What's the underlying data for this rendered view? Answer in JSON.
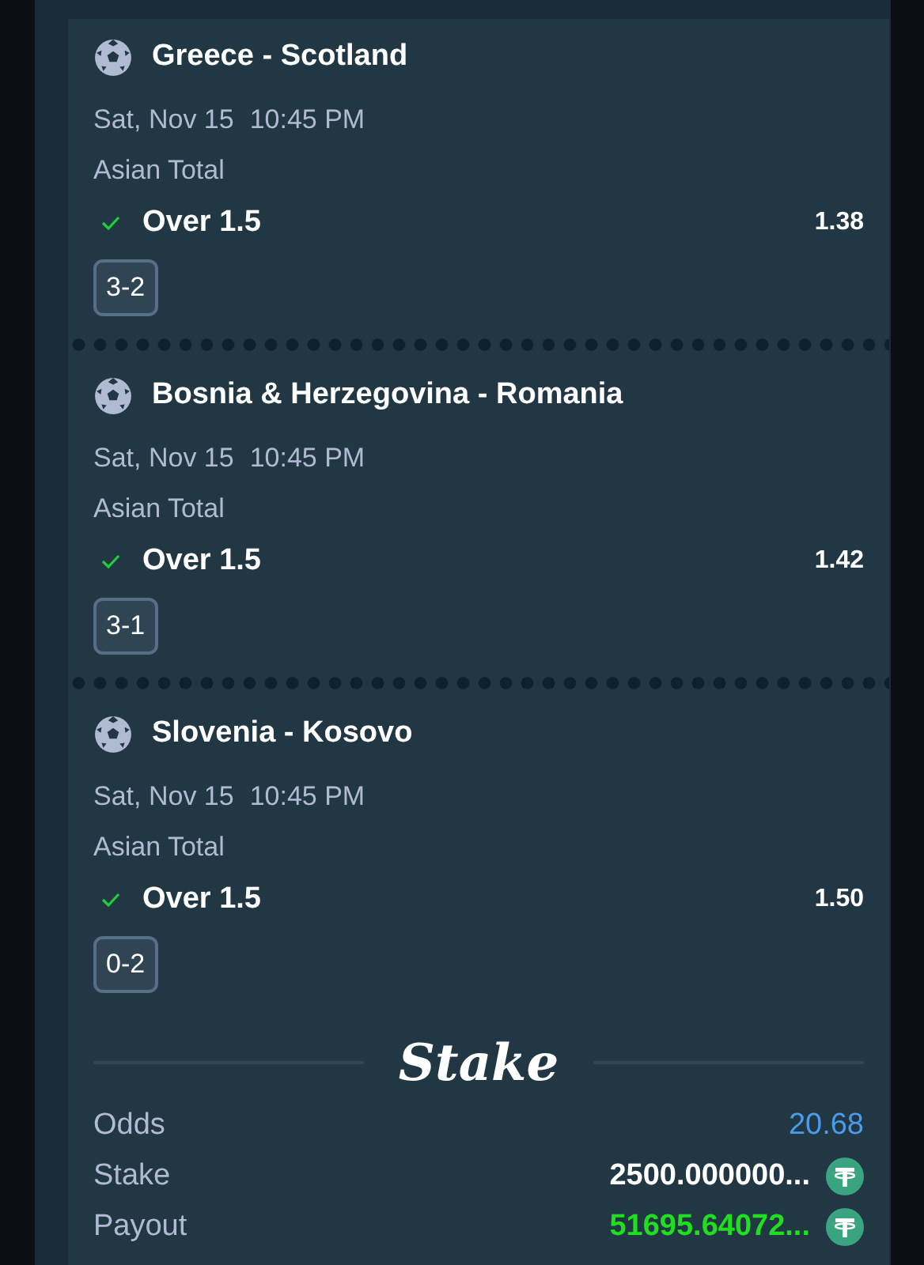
{
  "bets": [
    {
      "match": "Greece - Scotland",
      "date": "Sat, Nov 15",
      "time": "10:45 PM",
      "market": "Asian Total",
      "won": true,
      "selection": "Over 1.5",
      "odds": "1.38",
      "score": "3-2"
    },
    {
      "match": "Bosnia & Herzegovina - Romania",
      "date": "Sat, Nov 15",
      "time": "10:45 PM",
      "market": "Asian Total",
      "won": true,
      "selection": "Over 1.5",
      "odds": "1.42",
      "score": "3-1"
    },
    {
      "match": "Slovenia - Kosovo",
      "date": "Sat, Nov 15",
      "time": "10:45 PM",
      "market": "Asian Total",
      "won": true,
      "selection": "Over 1.5",
      "odds": "1.50",
      "score": "0-2"
    }
  ],
  "summary": {
    "brand": "Stake",
    "rows": [
      {
        "label": "Odds",
        "value": "20.68",
        "kind": "odds"
      },
      {
        "label": "Stake",
        "value": "2500.000000...",
        "kind": "amount"
      },
      {
        "label": "Payout",
        "value": "51695.64072...",
        "kind": "payout"
      }
    ]
  }
}
